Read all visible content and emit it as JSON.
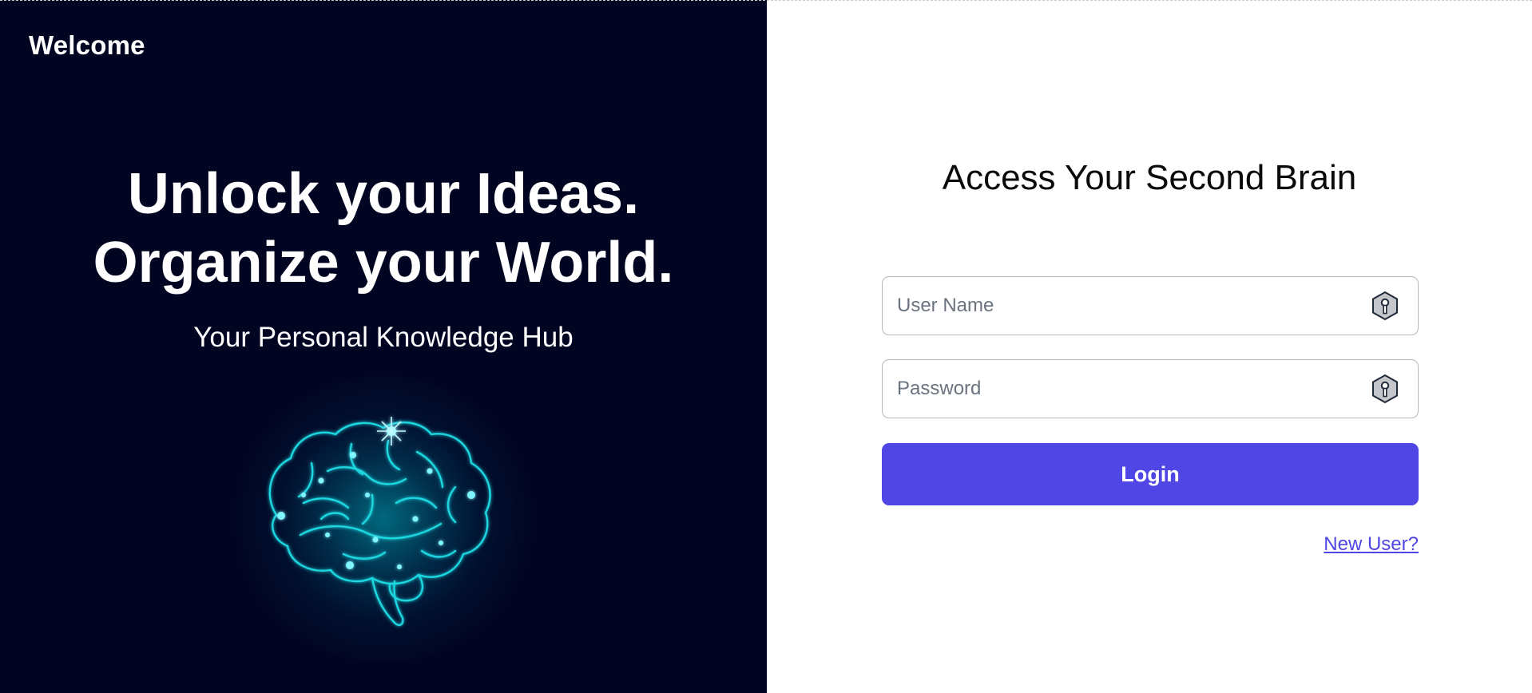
{
  "hero": {
    "brand": "Welcome",
    "headline_line1": "Unlock your Ideas.",
    "headline_line2": "Organize your World.",
    "tagline": "Your Personal Knowledge Hub",
    "illustration": "glowing-brain-icon"
  },
  "login": {
    "title": "Access Your Second Brain",
    "username_placeholder": "User Name",
    "username_value": "",
    "password_placeholder": "Password",
    "password_value": "",
    "field_icon": "key-hexagon-icon",
    "submit_label": "Login",
    "new_user_link": "New User?"
  },
  "colors": {
    "hero_background": "#010522",
    "accent": "#4f46e5",
    "brain_glow": "#00d7e6",
    "text_light": "#ffffff",
    "text_dark": "#0a0a0a"
  }
}
